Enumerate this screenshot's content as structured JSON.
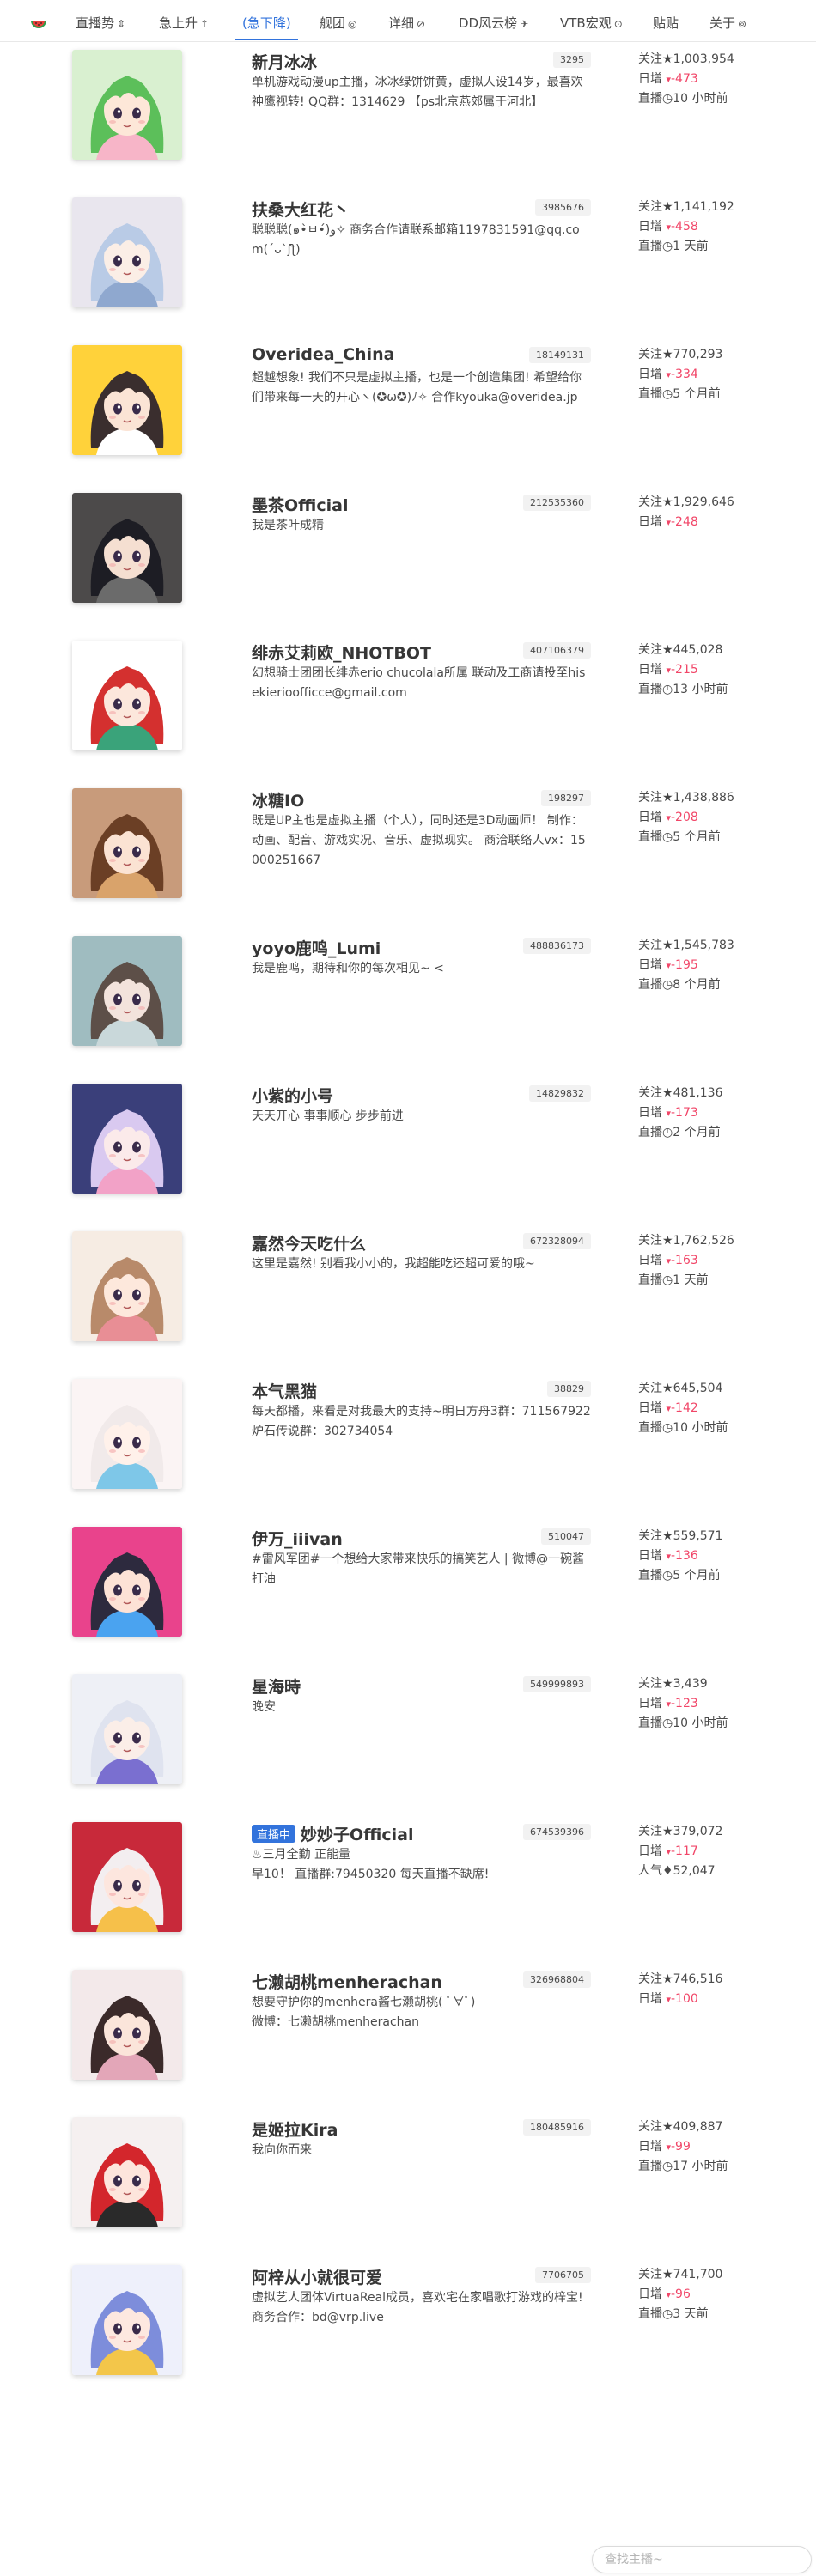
{
  "nav": {
    "items": [
      {
        "label": "直播势",
        "icon": "⇕",
        "active": false
      },
      {
        "label": "急上升",
        "icon": "↑",
        "active": false
      },
      {
        "label": "(急下降)",
        "icon": "",
        "active": true
      },
      {
        "label": "舰团",
        "icon": "◎",
        "active": false
      },
      {
        "label": "详细",
        "icon": "⊘",
        "active": false
      },
      {
        "label": "DD风云榜",
        "icon": "✈",
        "active": false
      },
      {
        "label": "VTB宏观",
        "icon": "⊙",
        "active": false
      },
      {
        "label": "贴贴",
        "icon": "",
        "active": false
      },
      {
        "label": "关于",
        "icon": "⊚",
        "active": false
      }
    ]
  },
  "accent": "#3273dc",
  "down_color": "#f14668",
  "entries": [
    {
      "name": "新月冰冰",
      "live": false,
      "uid": "3295",
      "desc": "单机游戏动漫up主播，冰冰绿饼饼黄，虚拟人设14岁，最喜欢神鹰视转! QQ群：1314629 【ps北京燕郊属于河北】",
      "followers": "1,003,954",
      "daily": "-473",
      "third_label": "直播",
      "third_icon": "◷",
      "third_value": "10 小时前",
      "avatar": {
        "bg": "#d9f0d0",
        "hair": "#5cbf5a",
        "face": "#fde7d8",
        "accent": "#f7b5c8"
      }
    },
    {
      "name": "扶桑大红花丶",
      "live": false,
      "uid": "3985676",
      "desc": "聪聪聪(๑•̀ㅂ•́)و✧ 商务合作请联系邮箱1197831591@qq.com(´ᴗ`ʃƪ)",
      "followers": "1,141,192",
      "daily": "-458",
      "third_label": "直播",
      "third_icon": "◷",
      "third_value": "1 天前",
      "avatar": {
        "bg": "#e9e6ee",
        "hair": "#b9cbe6",
        "face": "#fbeee6",
        "accent": "#8fa8cf"
      }
    },
    {
      "name": "Overidea_China",
      "live": false,
      "uid": "18149131",
      "desc": "超越想象! 我们不只是虚拟主播，也是一个创造集团! 希望给你们带来每一天的开心ヽ(✪ω✪)ﾉ✧ 合作kyouka@overidea.jp",
      "followers": "770,293",
      "daily": "-334",
      "third_label": "直播",
      "third_icon": "◷",
      "third_value": "5 个月前",
      "avatar": {
        "bg": "#ffd23a",
        "hair": "#3a2e2e",
        "face": "#fbe4d5",
        "accent": "#ffffff"
      }
    },
    {
      "name": "墨茶Official",
      "live": false,
      "uid": "212535360",
      "desc": "我是茶叶成精",
      "followers": "1,929,646",
      "daily": "-248",
      "third_label": "",
      "third_icon": "",
      "third_value": "",
      "avatar": {
        "bg": "#4c4a4a",
        "hair": "#1d1d24",
        "face": "#f5dfd1",
        "accent": "#6b6b6b"
      }
    },
    {
      "name": "绯赤艾莉欧_NHOTBOT",
      "live": false,
      "uid": "407106379",
      "desc": "幻想骑士团团长绯赤erio chucolala所属 联动及工商请投至hisekierioofficce@gmail.com",
      "followers": "445,028",
      "daily": "-215",
      "third_label": "直播",
      "third_icon": "◷",
      "third_value": "13 小时前",
      "avatar": {
        "bg": "#ffffff",
        "hair": "#d4302f",
        "face": "#fce7dc",
        "accent": "#3aa37a"
      }
    },
    {
      "name": "冰糖IO",
      "live": false,
      "uid": "198297",
      "desc": "既是UP主也是虚拟主播（个人），同时还是3D动画师！ 制作：动画、配音、游戏实况、音乐、虚拟现实。 商洽联络人vx：15000251667",
      "followers": "1,438,886",
      "daily": "-208",
      "third_label": "直播",
      "third_icon": "◷",
      "third_value": "5 个月前",
      "avatar": {
        "bg": "#c89b7b",
        "hair": "#6b3f25",
        "face": "#fbe3d3",
        "accent": "#d9a36b"
      }
    },
    {
      "name": "yoyo鹿鸣_Lumi",
      "live": false,
      "uid": "488836173",
      "desc": "我是鹿鸣，期待和你的每次相见~ <",
      "followers": "1,545,783",
      "daily": "-195",
      "third_label": "直播",
      "third_icon": "◷",
      "third_value": "8 个月前",
      "avatar": {
        "bg": "#9fbcc0",
        "hair": "#5d4f48",
        "face": "#f3e3dc",
        "accent": "#c9d8da"
      }
    },
    {
      "name": "小紫的小号",
      "live": false,
      "uid": "14829832",
      "desc": "天天开心 事事顺心 步步前进",
      "followers": "481,136",
      "daily": "-173",
      "third_label": "直播",
      "third_icon": "◷",
      "third_value": "2 个月前",
      "avatar": {
        "bg": "#3a3f7a",
        "hair": "#d9c9f0",
        "face": "#fbeaea",
        "accent": "#f2a2c7"
      }
    },
    {
      "name": "嘉然今天吃什么",
      "live": false,
      "uid": "672328094",
      "desc": "这里是嘉然! 别看我小小的，我超能吃还超可爱的哦~",
      "followers": "1,762,526",
      "daily": "-163",
      "third_label": "直播",
      "third_icon": "◷",
      "third_value": "1 天前",
      "avatar": {
        "bg": "#f6ece3",
        "hair": "#b88a6a",
        "face": "#fde8dc",
        "accent": "#e88e95"
      }
    },
    {
      "name": "本气黑猫",
      "live": false,
      "uid": "38829",
      "desc": "每天都播，来看是对我最大的支持~明日方舟3群：711567922 炉石传说群：302734054",
      "followers": "645,504",
      "daily": "-142",
      "third_label": "直播",
      "third_icon": "◷",
      "third_value": "10 小时前",
      "avatar": {
        "bg": "#fbf4f4",
        "hair": "#f1eaea",
        "face": "#fff1ea",
        "accent": "#7ec7e8"
      }
    },
    {
      "name": "伊万_iiivan",
      "live": false,
      "uid": "510047",
      "desc": "#雷风军团#一个想给大家带来快乐的搞笑艺人 | 微博@一碗酱打油",
      "followers": "559,571",
      "daily": "-136",
      "third_label": "直播",
      "third_icon": "◷",
      "third_value": "5 个月前",
      "avatar": {
        "bg": "#e9438c",
        "hair": "#2d2a3e",
        "face": "#fde2d6",
        "accent": "#4aa3f0"
      }
    },
    {
      "name": "星海時",
      "live": false,
      "uid": "549999893",
      "desc": "晚安",
      "followers": "3,439",
      "daily": "-123",
      "third_label": "直播",
      "third_icon": "◷",
      "third_value": "10 小时前",
      "avatar": {
        "bg": "#eef0f6",
        "hair": "#dfe3ef",
        "face": "#fbeee8",
        "accent": "#7a6fd0"
      }
    },
    {
      "name": "妙妙子Official",
      "live": true,
      "live_label": "直播中",
      "uid": "674539396",
      "desc": "♨三月全勤 正能量\n早10！ 直播群:79450320 每天直播不缺席!",
      "followers": "379,072",
      "daily": "-117",
      "third_label": "人气",
      "third_icon": "♦",
      "third_value": "52,047",
      "avatar": {
        "bg": "#c8293a",
        "hair": "#f3eef0",
        "face": "#fde6de",
        "accent": "#f6c04a"
      }
    },
    {
      "name": "七濑胡桃menherachan",
      "live": false,
      "uid": "326968804",
      "desc": "想要守护你的menhera酱七濑胡桃( ﾟ∀ﾟ)\n微博：七濑胡桃menherachan",
      "followers": "746,516",
      "daily": "-100",
      "third_label": "",
      "third_icon": "",
      "third_value": "",
      "avatar": {
        "bg": "#f3e9ea",
        "hair": "#3b2a2a",
        "face": "#fbe5da",
        "accent": "#e3a6b8"
      }
    },
    {
      "name": "是姬拉Kira",
      "live": false,
      "uid": "180485916",
      "desc": "我向你而来",
      "followers": "409,887",
      "daily": "-99",
      "third_label": "直播",
      "third_icon": "◷",
      "third_value": "17 小时前",
      "avatar": {
        "bg": "#f5f0f0",
        "hair": "#d3262c",
        "face": "#fde5dc",
        "accent": "#2a2a2a"
      }
    },
    {
      "name": "阿梓从小就很可爱",
      "live": false,
      "uid": "7706705",
      "desc": "虚拟艺人团体VirtuaReal成员，喜欢宅在家唱歌打游戏的梓宝! 商务合作：bd@vrp.live",
      "followers": "741,700",
      "daily": "-96",
      "third_label": "直播",
      "third_icon": "◷",
      "third_value": "3 天前",
      "avatar": {
        "bg": "#eef0fb",
        "hair": "#7d8ddb",
        "face": "#fde8e0",
        "accent": "#f3c64a"
      }
    }
  ],
  "labels": {
    "followers": "关注",
    "daily": "日增",
    "star": "★",
    "down": "▾"
  },
  "search": {
    "placeholder": "查找主播~",
    "value": ""
  }
}
